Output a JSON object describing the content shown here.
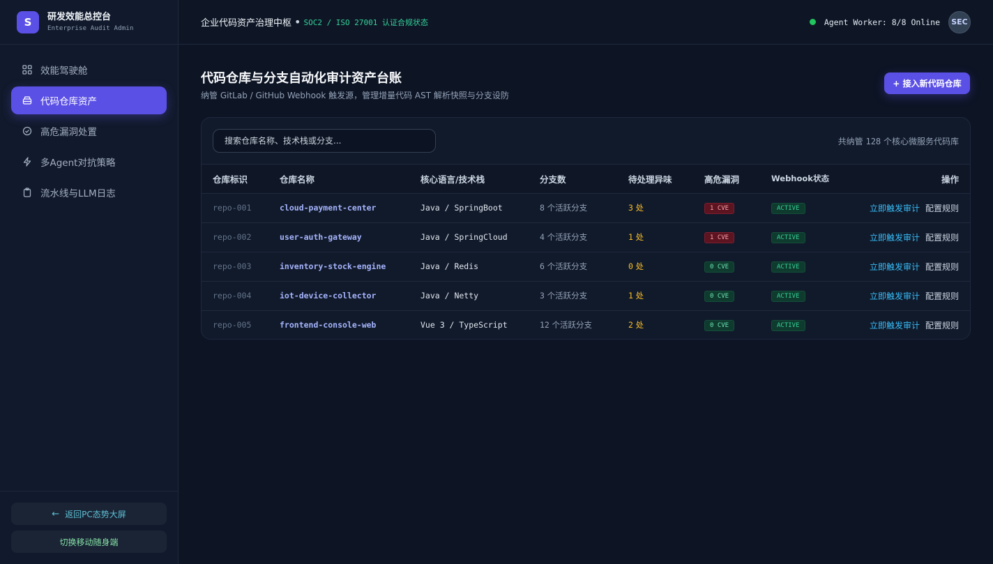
{
  "brand": {
    "logo": "S",
    "title": "研发效能总控台",
    "subtitle": "Enterprise Audit Admin"
  },
  "sidebar": {
    "items": [
      {
        "label": "效能驾驶舱",
        "icon": "grid-icon",
        "active": false
      },
      {
        "label": "代码仓库资产",
        "icon": "database-icon",
        "active": true
      },
      {
        "label": "高危漏洞处置",
        "icon": "check-circle-icon",
        "active": false
      },
      {
        "label": "多Agent对抗策略",
        "icon": "lightning-icon",
        "active": false
      },
      {
        "label": "流水线与LLM日志",
        "icon": "clipboard-icon",
        "active": false
      }
    ],
    "back_button": "返回PC态势大屏",
    "mobile_button": "切换移动随身端"
  },
  "header": {
    "title": "企业代码资产治理中枢",
    "separator": "•",
    "cert": "SOC2 / ISO 27001 认证合规状态",
    "agent_status": "Agent Worker: 8/8 Online",
    "avatar": "SEC"
  },
  "main": {
    "title": "代码仓库与分支自动化审计资产台账",
    "subtitle": "纳管 GitLab / GitHub Webhook 触发源，管理增量代码 AST 解析快照与分支设防",
    "add_button": "+ 接入新代码仓库",
    "search_placeholder": "搜索仓库名称、技术栈或分支...",
    "count_prefix": "共纳管",
    "count_value": "128",
    "count_suffix": "个核心微服务代码库"
  },
  "table": {
    "headers": [
      "仓库标识",
      "仓库名称",
      "核心语言/技术栈",
      "分支数",
      "待处理异味",
      "高危漏洞",
      "Webhook状态",
      "操作"
    ],
    "rows": [
      {
        "id": "repo-001",
        "name": "cloud-payment-center",
        "stack": "Java / SpringBoot",
        "branches_num": "8",
        "branches_unit": "个活跃分支",
        "smells_num": "3",
        "smells_unit": "处",
        "cve": "1 CVE",
        "cve_level": "red",
        "webhook": "ACTIVE",
        "action_trigger": "立即触发审计",
        "action_config": "配置规则"
      },
      {
        "id": "repo-002",
        "name": "user-auth-gateway",
        "stack": "Java / SpringCloud",
        "branches_num": "4",
        "branches_unit": "个活跃分支",
        "smells_num": "1",
        "smells_unit": "处",
        "cve": "1 CVE",
        "cve_level": "red",
        "webhook": "ACTIVE",
        "action_trigger": "立即触发审计",
        "action_config": "配置规则"
      },
      {
        "id": "repo-003",
        "name": "inventory-stock-engine",
        "stack": "Java / Redis",
        "branches_num": "6",
        "branches_unit": "个活跃分支",
        "smells_num": "0",
        "smells_unit": "处",
        "cve": "0 CVE",
        "cve_level": "green",
        "webhook": "ACTIVE",
        "action_trigger": "立即触发审计",
        "action_config": "配置规则"
      },
      {
        "id": "repo-004",
        "name": "iot-device-collector",
        "stack": "Java / Netty",
        "branches_num": "3",
        "branches_unit": "个活跃分支",
        "smells_num": "1",
        "smells_unit": "处",
        "cve": "0 CVE",
        "cve_level": "green",
        "webhook": "ACTIVE",
        "action_trigger": "立即触发审计",
        "action_config": "配置规则"
      },
      {
        "id": "repo-005",
        "name": "frontend-console-web",
        "stack": "Vue 3 / TypeScript",
        "branches_num": "12",
        "branches_unit": "个活跃分支",
        "smells_num": "2",
        "smells_unit": "处",
        "cve": "0 CVE",
        "cve_level": "green",
        "webhook": "ACTIVE",
        "action_trigger": "立即触发审计",
        "action_config": "配置规则"
      }
    ]
  },
  "colors": {
    "accent": "#5b50e6",
    "bg": "#0d1424",
    "online": "#22c55e",
    "warn": "#fbbf24"
  }
}
